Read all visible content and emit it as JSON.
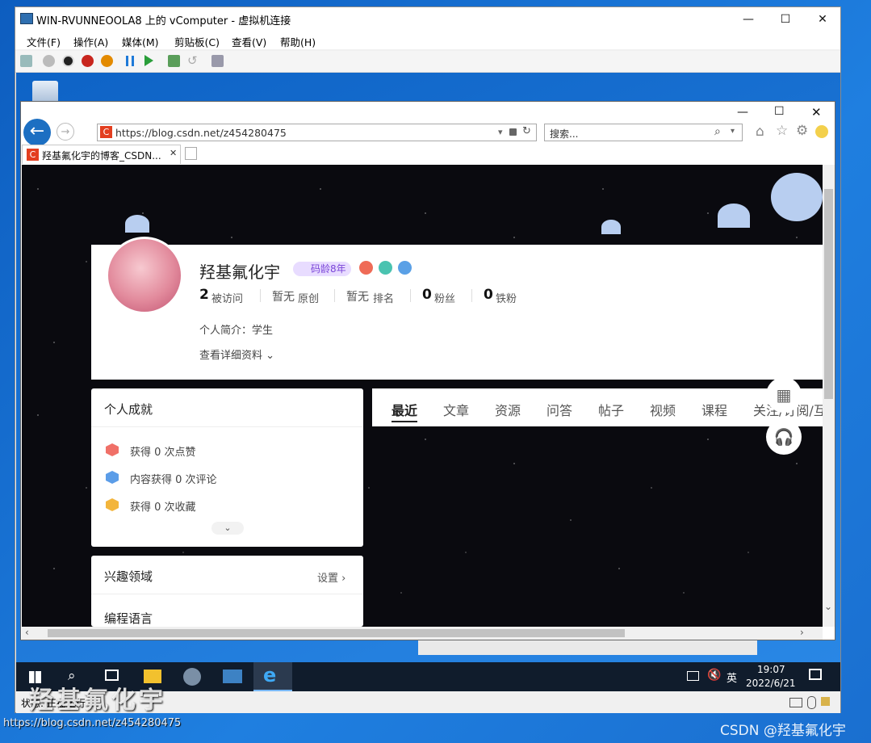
{
  "vm": {
    "title": "WIN-RVUNNEOOLA8 上的 vComputer - 虚拟机连接",
    "menu": [
      "文件(F)",
      "操作(A)",
      "媒体(M)",
      "剪贴板(C)",
      "查看(V)",
      "帮助(H)"
    ],
    "status": "状态: 正在运行"
  },
  "ie": {
    "url": "https://blog.csdn.net/z454280475",
    "search_placeholder": "搜索...",
    "tab_title": "羟基氟化宇的博客_CSDN..."
  },
  "profile": {
    "name": "羟基氟化宇",
    "badge": "码龄8年",
    "stats": [
      {
        "value": "2",
        "label": "被访问"
      },
      {
        "value": "暂无",
        "label": "原创"
      },
      {
        "value": "暂无",
        "label": "排名"
      },
      {
        "value": "0",
        "label": "粉丝"
      },
      {
        "value": "0",
        "label": "铁粉"
      }
    ],
    "bio": "个人简介：学生",
    "details_link": "查看详细资料"
  },
  "achievements": {
    "title": "个人成就",
    "items": [
      "获得 0 次点赞",
      "内容获得 0 次评论",
      "获得 0 次收藏"
    ]
  },
  "interests": {
    "title": "兴趣领域",
    "settings": "设置",
    "first_item": "编程语言"
  },
  "tabs": [
    "最近",
    "文章",
    "资源",
    "问答",
    "帖子",
    "视频",
    "课程",
    "关注/订阅/互"
  ],
  "taskbar": {
    "time": "19:07",
    "date": "2022/6/21",
    "ime": "英"
  },
  "watermarks": {
    "big": "羟基氟化宇",
    "url": "https://blog.csdn.net/z454280475",
    "credit": "CSDN @羟基氟化宇"
  }
}
